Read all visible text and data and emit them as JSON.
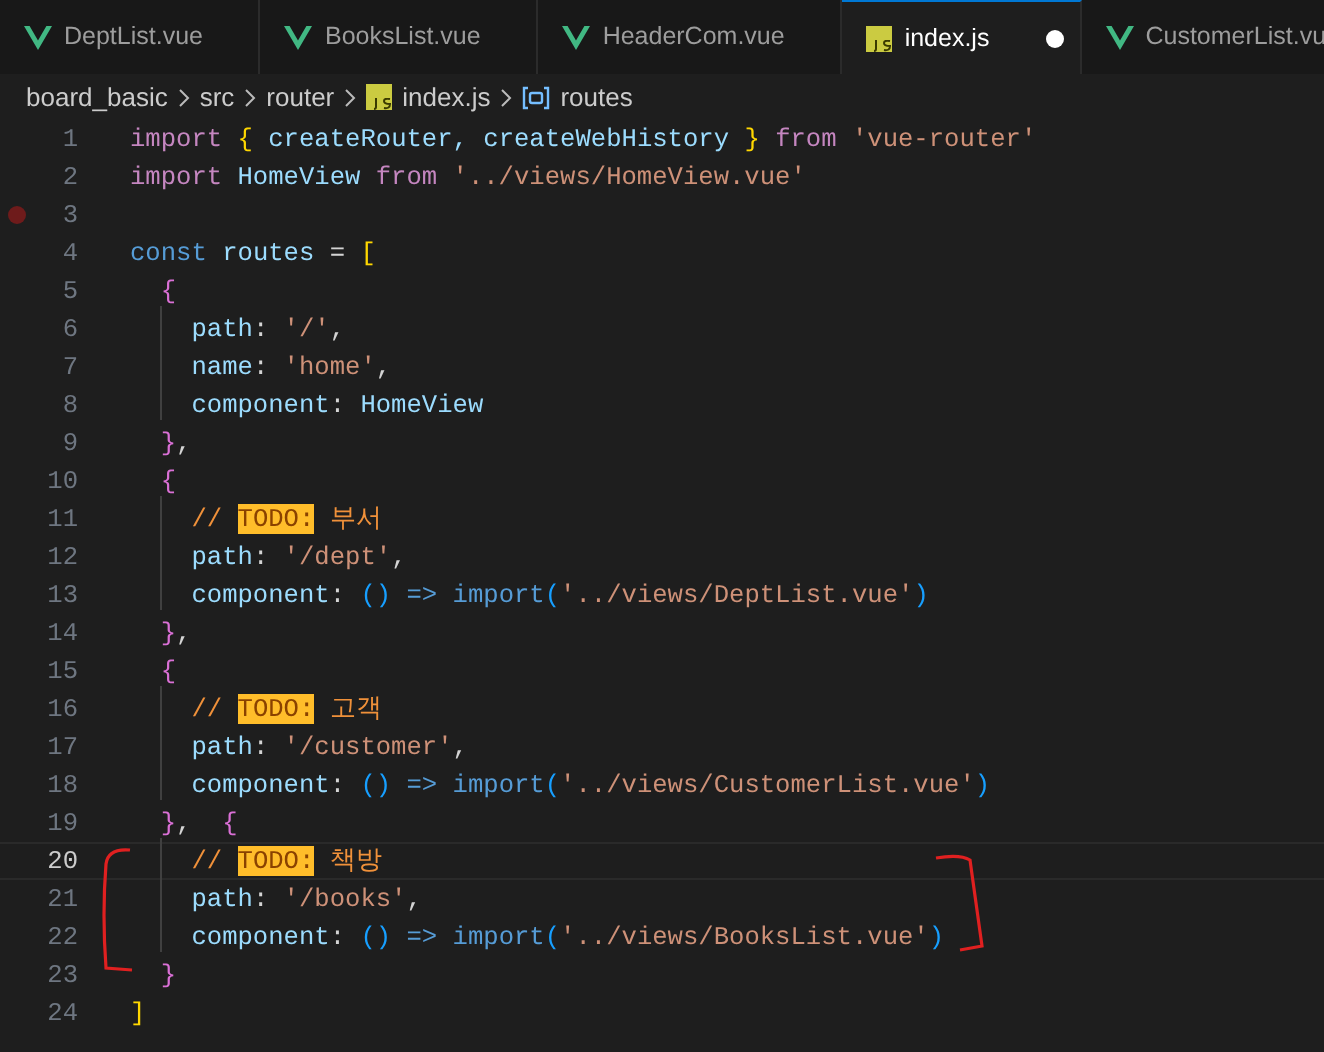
{
  "tabs": [
    {
      "label": "DeptList.vue",
      "kind": "vue",
      "selected": false,
      "modified": false
    },
    {
      "label": "BooksList.vue",
      "kind": "vue",
      "selected": false,
      "modified": false
    },
    {
      "label": "HeaderCom.vue",
      "kind": "vue",
      "selected": false,
      "modified": false
    },
    {
      "label": "index.js",
      "kind": "js",
      "selected": true,
      "modified": true
    },
    {
      "label": "CustomerList.vu",
      "kind": "vue",
      "selected": false,
      "modified": false
    }
  ],
  "breadcrumb": [
    {
      "label": "board_basic",
      "kind": "folder"
    },
    {
      "label": "src",
      "kind": "folder"
    },
    {
      "label": "router",
      "kind": "folder"
    },
    {
      "label": "index.js",
      "kind": "js"
    },
    {
      "label": "routes",
      "kind": "symbol"
    }
  ],
  "lines": [
    {
      "number": "1",
      "current": false,
      "breakpoint": false,
      "tokens": [
        {
          "text": "import ",
          "kind": "kw"
        },
        {
          "text": "{",
          "kind": "b1"
        },
        {
          "text": " createRouter, createWebHistory ",
          "kind": "var"
        },
        {
          "text": "}",
          "kind": "b1"
        },
        {
          "text": " from ",
          "kind": "kw"
        },
        {
          "text": "'vue-router'",
          "kind": "str"
        }
      ]
    },
    {
      "number": "2",
      "current": false,
      "breakpoint": false,
      "tokens": [
        {
          "text": "import",
          "kind": "kw"
        },
        {
          "text": " HomeView ",
          "kind": "var"
        },
        {
          "text": "from",
          "kind": "kw"
        },
        {
          "text": " '../views/HomeView.vue'",
          "kind": "str"
        }
      ]
    },
    {
      "number": "3",
      "current": false,
      "breakpoint": true
    },
    {
      "number": "4",
      "current": false,
      "breakpoint": false,
      "tokens": [
        {
          "text": "const",
          "kind": "decl"
        },
        {
          "text": " routes ",
          "kind": "var"
        },
        {
          "text": "= ",
          "kind": "punct"
        },
        {
          "text": "[",
          "kind": "b1"
        }
      ]
    },
    {
      "number": "5",
      "current": false,
      "breakpoint": false,
      "tokens": [
        {
          "text": "  {",
          "kind": "b2"
        }
      ]
    },
    {
      "number": "6",
      "current": false,
      "breakpoint": false,
      "tokens": [
        {
          "text": "    path",
          "kind": "var"
        },
        {
          "text": ": ",
          "kind": "punct"
        },
        {
          "text": "'/'",
          "kind": "str"
        },
        {
          "text": ",",
          "kind": "punct"
        }
      ]
    },
    {
      "number": "7",
      "current": false,
      "breakpoint": false,
      "tokens": [
        {
          "text": "    name",
          "kind": "var"
        },
        {
          "text": ": ",
          "kind": "punct"
        },
        {
          "text": "'home'",
          "kind": "str"
        },
        {
          "text": ",",
          "kind": "punct"
        }
      ]
    },
    {
      "number": "8",
      "current": false,
      "breakpoint": false,
      "tokens": [
        {
          "text": "    component",
          "kind": "var"
        },
        {
          "text": ": ",
          "kind": "punct"
        },
        {
          "text": "HomeView",
          "kind": "var"
        }
      ]
    },
    {
      "number": "9",
      "current": false,
      "breakpoint": false,
      "tokens": [
        {
          "text": "  }",
          "kind": "b2"
        },
        {
          "text": ",",
          "kind": "punct"
        }
      ]
    },
    {
      "number": "10",
      "current": false,
      "breakpoint": false,
      "tokens": [
        {
          "text": "  {",
          "kind": "b2"
        }
      ]
    },
    {
      "number": "11",
      "current": false,
      "breakpoint": false,
      "tokens": [
        {
          "text": "    // ",
          "kind": "comment"
        },
        {
          "text": "TODO:",
          "kind": "todo"
        },
        {
          "text": " 부서",
          "kind": "comment"
        }
      ]
    },
    {
      "number": "12",
      "current": false,
      "breakpoint": false,
      "tokens": [
        {
          "text": "    path",
          "kind": "var"
        },
        {
          "text": ": ",
          "kind": "punct"
        },
        {
          "text": "'/dept'",
          "kind": "str"
        },
        {
          "text": ",",
          "kind": "punct"
        }
      ]
    },
    {
      "number": "13",
      "current": false,
      "breakpoint": false,
      "tokens": [
        {
          "text": "    component",
          "kind": "var"
        },
        {
          "text": ": ",
          "kind": "punct"
        },
        {
          "text": "()",
          "kind": "b3"
        },
        {
          "text": " => import",
          "kind": "decl"
        },
        {
          "text": "(",
          "kind": "b3"
        },
        {
          "text": "'../views/DeptList.vue'",
          "kind": "str"
        },
        {
          "text": ")",
          "kind": "b3"
        }
      ]
    },
    {
      "number": "14",
      "current": false,
      "breakpoint": false,
      "tokens": [
        {
          "text": "  }",
          "kind": "b2"
        },
        {
          "text": ",",
          "kind": "punct"
        }
      ]
    },
    {
      "number": "15",
      "current": false,
      "breakpoint": false,
      "tokens": [
        {
          "text": "  {",
          "kind": "b2"
        }
      ]
    },
    {
      "number": "16",
      "current": false,
      "breakpoint": false,
      "tokens": [
        {
          "text": "    // ",
          "kind": "comment"
        },
        {
          "text": "TODO:",
          "kind": "todo"
        },
        {
          "text": " 고객",
          "kind": "comment"
        }
      ]
    },
    {
      "number": "17",
      "current": false,
      "breakpoint": false,
      "tokens": [
        {
          "text": "    path",
          "kind": "var"
        },
        {
          "text": ": ",
          "kind": "punct"
        },
        {
          "text": "'/customer'",
          "kind": "str"
        },
        {
          "text": ",",
          "kind": "punct"
        }
      ]
    },
    {
      "number": "18",
      "current": false,
      "breakpoint": false,
      "tokens": [
        {
          "text": "    component",
          "kind": "var"
        },
        {
          "text": ": ",
          "kind": "punct"
        },
        {
          "text": "()",
          "kind": "b3"
        },
        {
          "text": " => import",
          "kind": "decl"
        },
        {
          "text": "(",
          "kind": "b3"
        },
        {
          "text": "'../views/CustomerList.vue'",
          "kind": "str"
        },
        {
          "text": ")",
          "kind": "b3"
        }
      ]
    },
    {
      "number": "19",
      "current": false,
      "breakpoint": false,
      "tokens": [
        {
          "text": "  }",
          "kind": "b2"
        },
        {
          "text": ",  ",
          "kind": "punct"
        },
        {
          "text": "{",
          "kind": "b2"
        }
      ]
    },
    {
      "number": "20",
      "current": true,
      "breakpoint": false,
      "tokens": [
        {
          "text": "    // ",
          "kind": "comment"
        },
        {
          "text": "TODO:",
          "kind": "todo"
        },
        {
          "text": " 책방",
          "kind": "comment"
        }
      ]
    },
    {
      "number": "21",
      "current": false,
      "breakpoint": false,
      "tokens": [
        {
          "text": "    path",
          "kind": "var"
        },
        {
          "text": ": ",
          "kind": "punct"
        },
        {
          "text": "'/books'",
          "kind": "str"
        },
        {
          "text": ",",
          "kind": "punct"
        }
      ]
    },
    {
      "number": "22",
      "current": false,
      "breakpoint": false,
      "tokens": [
        {
          "text": "    component",
          "kind": "var"
        },
        {
          "text": ": ",
          "kind": "punct"
        },
        {
          "text": "()",
          "kind": "b3"
        },
        {
          "text": " => import",
          "kind": "decl"
        },
        {
          "text": "(",
          "kind": "b3"
        },
        {
          "text": "'../views/BooksList.vue'",
          "kind": "str"
        },
        {
          "text": ")",
          "kind": "b3"
        }
      ]
    },
    {
      "number": "23",
      "current": false,
      "breakpoint": false,
      "tokens": [
        {
          "text": "  }",
          "kind": "b2"
        }
      ]
    },
    {
      "number": "24",
      "current": false,
      "breakpoint": false,
      "tokens": [
        {
          "text": "]",
          "kind": "b1"
        }
      ]
    }
  ]
}
